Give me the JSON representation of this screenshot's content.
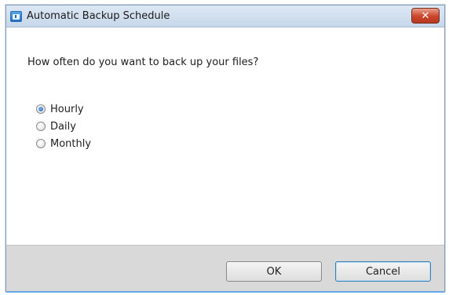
{
  "window": {
    "title": "Automatic Backup Schedule",
    "close_symbol": "✕"
  },
  "dialog": {
    "question": "How often do you want to back up your files?",
    "options": [
      {
        "label": "Hourly",
        "selected": true
      },
      {
        "label": "Daily",
        "selected": false
      },
      {
        "label": "Monthly",
        "selected": false
      }
    ]
  },
  "buttons": {
    "ok_label": "OK",
    "cancel_label": "Cancel"
  },
  "colors": {
    "titlebar": "#c7d7ea",
    "close": "#c9452a",
    "footer": "#d9d9d9",
    "accent": "#66a8e6"
  }
}
